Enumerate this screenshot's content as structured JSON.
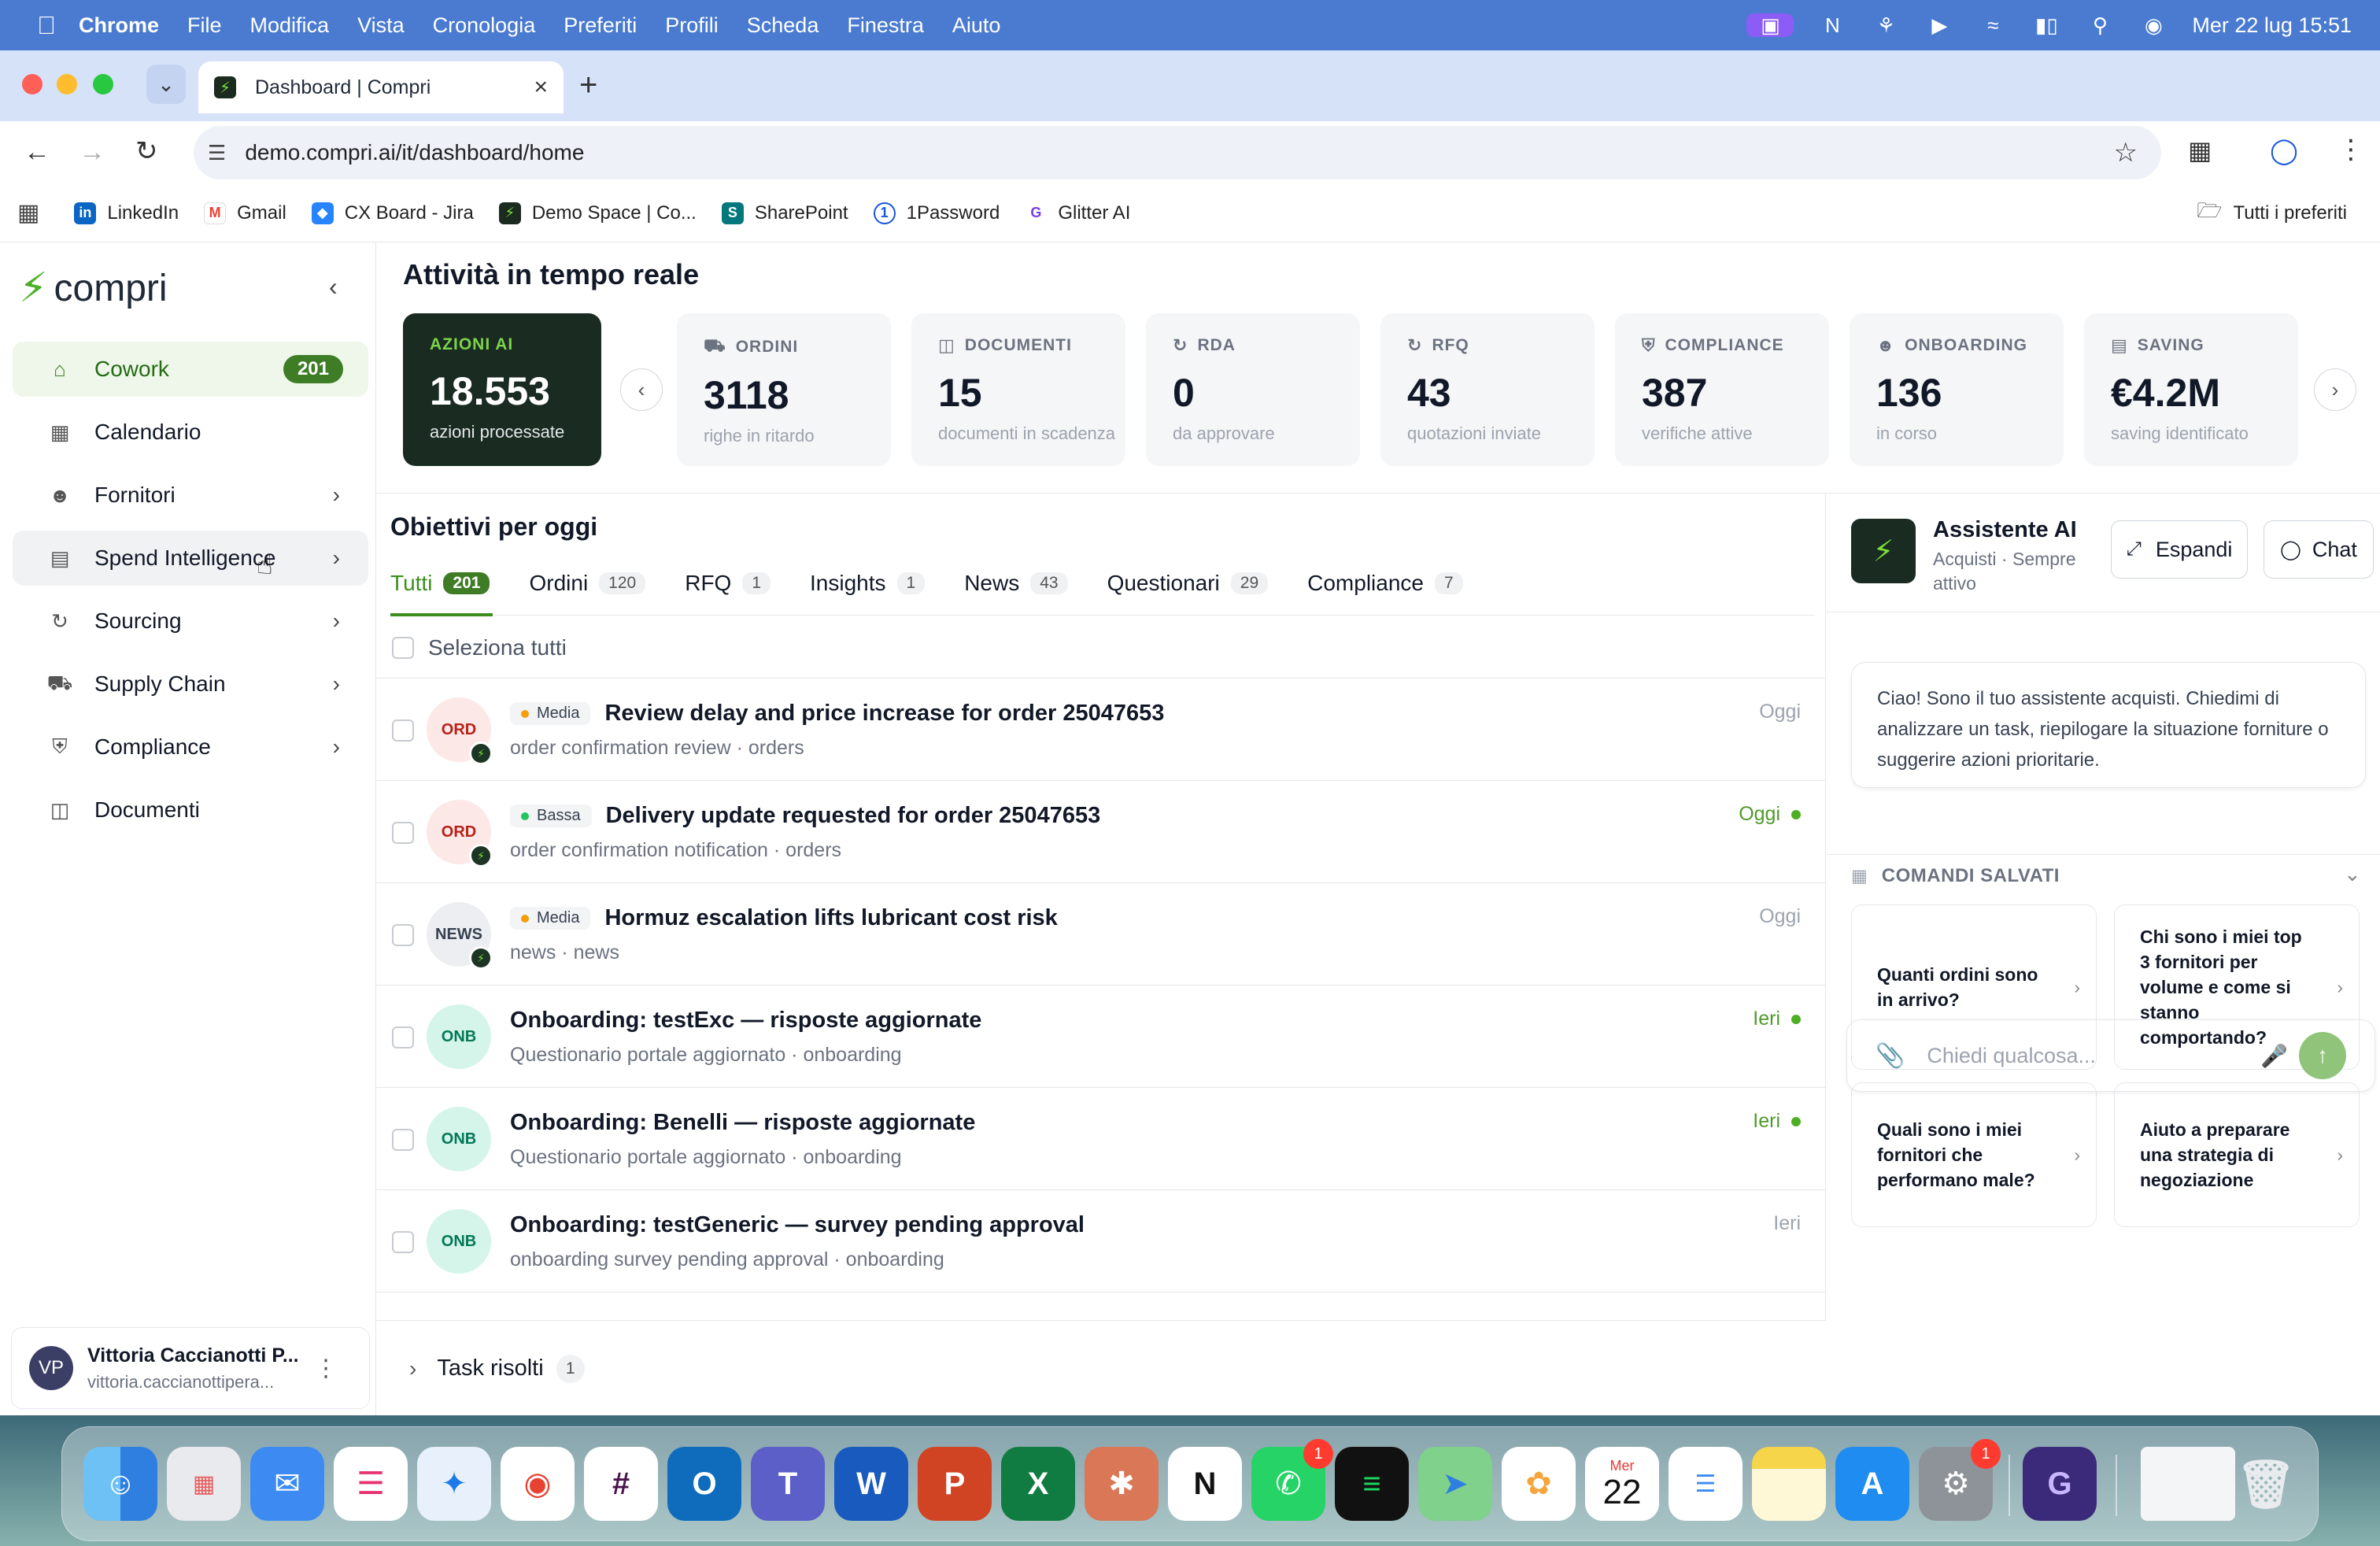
{
  "menubar": {
    "app": "Chrome",
    "items": [
      "File",
      "Modifica",
      "Vista",
      "Cronologia",
      "Preferiti",
      "Profili",
      "Scheda",
      "Finestra",
      "Aiuto"
    ],
    "clock": "Mer 22 lug  15:51"
  },
  "browser": {
    "tab_title": "Dashboard | Compri",
    "url": "demo.compri.ai/it/dashboard/home",
    "bookmarks": [
      "LinkedIn",
      "Gmail",
      "CX Board - Jira",
      "Demo Space | Co...",
      "SharePoint",
      "1Password",
      "Glitter AI"
    ],
    "all_bookmarks": "Tutti i preferiti"
  },
  "sidebar": {
    "logo": "compri",
    "items": [
      {
        "label": "Cowork",
        "badge": "201"
      },
      {
        "label": "Calendario"
      },
      {
        "label": "Fornitori"
      },
      {
        "label": "Spend Intelligence"
      },
      {
        "label": "Sourcing"
      },
      {
        "label": "Supply Chain"
      },
      {
        "label": "Compliance"
      },
      {
        "label": "Documenti"
      }
    ],
    "user": {
      "initials": "VP",
      "name": "Vittoria Caccianotti P...",
      "email": "vittoria.caccianottipera..."
    }
  },
  "realtime": {
    "title": "Attività in tempo reale",
    "stats": [
      {
        "label": "AZIONI AI",
        "value": "18.553",
        "sub": "azioni processate"
      },
      {
        "label": "ORDINI",
        "value": "3118",
        "sub": "righe in ritardo"
      },
      {
        "label": "DOCUMENTI",
        "value": "15",
        "sub": "documenti in scadenza"
      },
      {
        "label": "RDA",
        "value": "0",
        "sub": "da approvare"
      },
      {
        "label": "RFQ",
        "value": "43",
        "sub": "quotazioni inviate"
      },
      {
        "label": "COMPLIANCE",
        "value": "387",
        "sub": "verifiche attive"
      },
      {
        "label": "ONBOARDING",
        "value": "136",
        "sub": "in corso"
      },
      {
        "label": "SAVING",
        "value": "€4.2M",
        "sub": "saving identificato"
      }
    ]
  },
  "objectives": {
    "title": "Obiettivi per oggi",
    "tabs": [
      {
        "label": "Tutti",
        "count": "201"
      },
      {
        "label": "Ordini",
        "count": "120"
      },
      {
        "label": "RFQ",
        "count": "1"
      },
      {
        "label": "Insights",
        "count": "1"
      },
      {
        "label": "News",
        "count": "43"
      },
      {
        "label": "Questionari",
        "count": "29"
      },
      {
        "label": "Compliance",
        "count": "7"
      }
    ],
    "select_all": "Seleziona tutti",
    "tasks": [
      {
        "avatar": "ORD",
        "priority": "Media",
        "title": "Review delay and price increase for order 25047653",
        "sub": "order confirmation review · orders",
        "time": "Oggi"
      },
      {
        "avatar": "ORD",
        "priority": "Bassa",
        "title": "Delivery update requested for order 25047653",
        "sub": "order confirmation notification · orders",
        "time": "Oggi"
      },
      {
        "avatar": "NEWS",
        "priority": "Media",
        "title": "Hormuz escalation lifts lubricant cost risk",
        "sub": "news · news",
        "time": "Oggi"
      },
      {
        "avatar": "ONB",
        "title": "Onboarding: testExc — risposte aggiornate",
        "sub": "Questionario portale aggiornato · onboarding",
        "time": "Ieri"
      },
      {
        "avatar": "ONB",
        "title": "Onboarding: Benelli — risposte aggiornate",
        "sub": "Questionario portale aggiornato · onboarding",
        "time": "Ieri"
      },
      {
        "avatar": "ONB",
        "title": "Onboarding: testGeneric — survey pending approval",
        "sub": "onboarding survey pending approval · onboarding",
        "time": "Ieri"
      }
    ],
    "resolved": {
      "label": "Task risolti",
      "count": "1"
    }
  },
  "assistant": {
    "name": "Assistente AI",
    "subtitle": "Acquisti · Sempre attivo",
    "expand": "Espandi",
    "chat": "Chat",
    "greeting": "Ciao! Sono il tuo assistente acquisti. Chiedimi di analizzare un task, riepilogare la situazione forniture o suggerire azioni prioritarie.",
    "saved_header": "COMANDI SALVATI",
    "commands": [
      "Quanti ordini sono in arrivo?",
      "Chi sono i miei top 3 fornitori per volume e come si stanno comportando?",
      "Quali sono i miei fornitori che performano male?",
      "Aiuto a preparare una strategia di negoziazione"
    ],
    "placeholder": "Chiedi qualcosa..."
  },
  "dock": {
    "calendar_month": "Mer",
    "calendar_day": "22",
    "whatsapp_badge": "1",
    "settings_badge": "1"
  },
  "colors": {
    "accent": "#3e7d25",
    "dark_card": "#1a2b22",
    "menubar": "#4a7bd0"
  }
}
